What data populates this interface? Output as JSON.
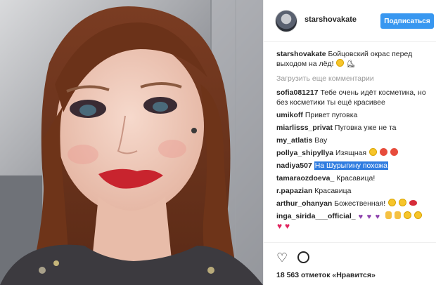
{
  "header": {
    "username": "starshovakate",
    "follow_label": "Подписаться"
  },
  "caption": {
    "username": "starshovakate",
    "text_line1": "Бойцовский окрас перед",
    "text_line2": "выходом на лёд!"
  },
  "load_more": "Загрузить еще комментарии",
  "comments": [
    {
      "user": "sofia081217",
      "text": "Тебе очень идёт косметика, но без косметики ты ещё красивее"
    },
    {
      "user": "umikoff",
      "text": "Привет пуговка"
    },
    {
      "user": "miarlisss_privat",
      "text": "Пуговка уже не та"
    },
    {
      "user": "my_atlatis",
      "text": "Вау"
    },
    {
      "user": "pollya_shipyllya",
      "text": "Изящная"
    },
    {
      "user": "nadiya507",
      "text": "На Шурыгину похожа"
    },
    {
      "user": "tamaraozdoeva_",
      "text": "Красавица!"
    },
    {
      "user": "r.papazian",
      "text": "Красавица"
    },
    {
      "user": "arthur_ohanyan",
      "text": "Божественная!"
    },
    {
      "user": "inga_sirida___official_",
      "text": ""
    }
  ],
  "likes_text": "18 563 отметок «Нравится»",
  "colors": {
    "follow_button": "#3897f0",
    "highlight": "#2f7ce0"
  },
  "icons": [
    "heart-outline-icon",
    "comment-bubble-icon"
  ]
}
